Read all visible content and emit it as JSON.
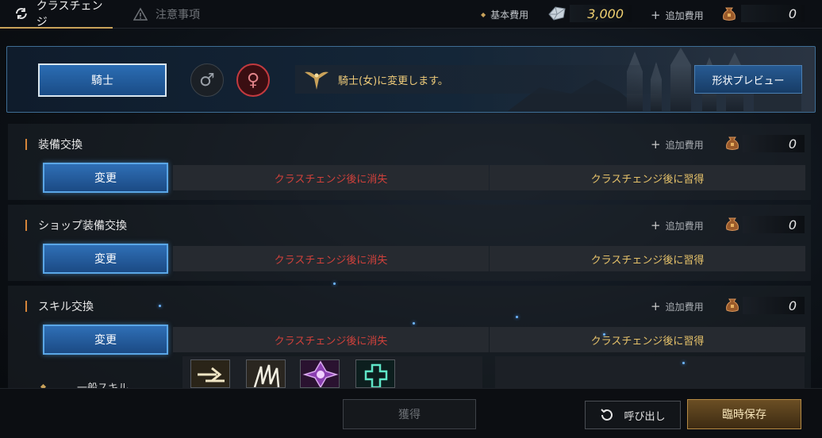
{
  "tabs": {
    "active": "クラスチェンジ",
    "inactive": "注意事項"
  },
  "costs": {
    "base_label": "基本費用",
    "base_value": "3,000",
    "add_label": "追加費用",
    "add_value": "0"
  },
  "class_panel": {
    "class_button": "騎士",
    "male_symbol": "♂",
    "female_symbol": "♀",
    "notice": "騎士(女)に変更します。",
    "preview_button": "形状プレビュー"
  },
  "sections": [
    {
      "title": "装備交換",
      "add_label": "追加費用",
      "add_value": "0",
      "change_button": "変更",
      "lost": "クラスチェンジ後に消失",
      "gain": "クラスチェンジ後に習得"
    },
    {
      "title": "ショップ装備交換",
      "add_label": "追加費用",
      "add_value": "0",
      "change_button": "変更",
      "lost": "クラスチェンジ後に消失",
      "gain": "クラスチェンジ後に習得"
    },
    {
      "title": "スキル交換",
      "add_label": "追加費用",
      "add_value": "0",
      "change_button": "変更",
      "lost": "クラスチェンジ後に消失",
      "gain": "クラスチェンジ後に習得"
    }
  ],
  "skills": {
    "label": "一般スキル",
    "icons": [
      "double-arrow-skill-icon",
      "claw-slash-skill-icon",
      "purple-sigil-skill-icon",
      "green-cross-skill-icon"
    ]
  },
  "bottom": {
    "acquire_button": "獲得",
    "recall_button": "呼び出し",
    "save_button": "臨時保存"
  },
  "colors": {
    "accent_gold": "#c9a25a",
    "button_blue": "#2b6db4",
    "lost_red": "#d0413b",
    "gain_gold": "#e6c26a"
  }
}
